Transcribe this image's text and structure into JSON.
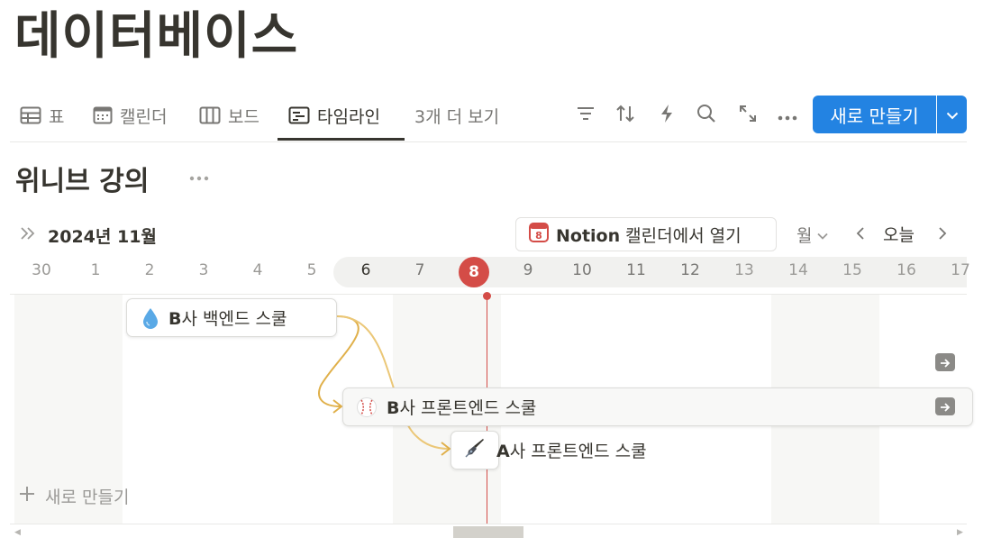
{
  "page": {
    "title": "데이터베이스"
  },
  "tabs": [
    {
      "label": "표",
      "icon": "table-icon"
    },
    {
      "label": "캘린더",
      "icon": "calendar-icon"
    },
    {
      "label": "보드",
      "icon": "board-icon"
    },
    {
      "label": "타임라인",
      "icon": "timeline-icon",
      "active": true
    },
    {
      "label": "3개 더 보기"
    }
  ],
  "toolbar": {
    "icons": [
      "filter-icon",
      "sort-icon",
      "automation-icon",
      "search-icon",
      "expand-icon",
      "more-icon"
    ],
    "new_label": "새로 만들기"
  },
  "view": {
    "title": "위니브 강의",
    "month": "2024년 11월",
    "open_calendar": {
      "brand": "Notion",
      "rest": " 캘린더에서 열기",
      "icon_day": "8"
    },
    "period": "월",
    "today": "오늘"
  },
  "timeline": {
    "dates": [
      "30",
      "1",
      "2",
      "3",
      "4",
      "5",
      "6",
      "7",
      "8",
      "9",
      "10",
      "11",
      "12",
      "13",
      "14",
      "15",
      "16",
      "17"
    ],
    "today_index": 8,
    "today_color": "#d44c47"
  },
  "items": [
    {
      "prefix": "B",
      "rest": "사 백엔드 스쿨",
      "icon": "droplet-icon"
    },
    {
      "prefix": "B",
      "rest": "사 프론트엔드 스쿨",
      "icon": "baseball-icon"
    },
    {
      "prefix": "A",
      "rest": "사 프론트엔드 스쿨",
      "icon": "fountain-pen-icon"
    }
  ],
  "add_row_label": "새로 만들기",
  "colors": {
    "accent": "#2383e2",
    "text": "#37352f",
    "muted": "#787774",
    "dependency": "#e0b04a"
  }
}
